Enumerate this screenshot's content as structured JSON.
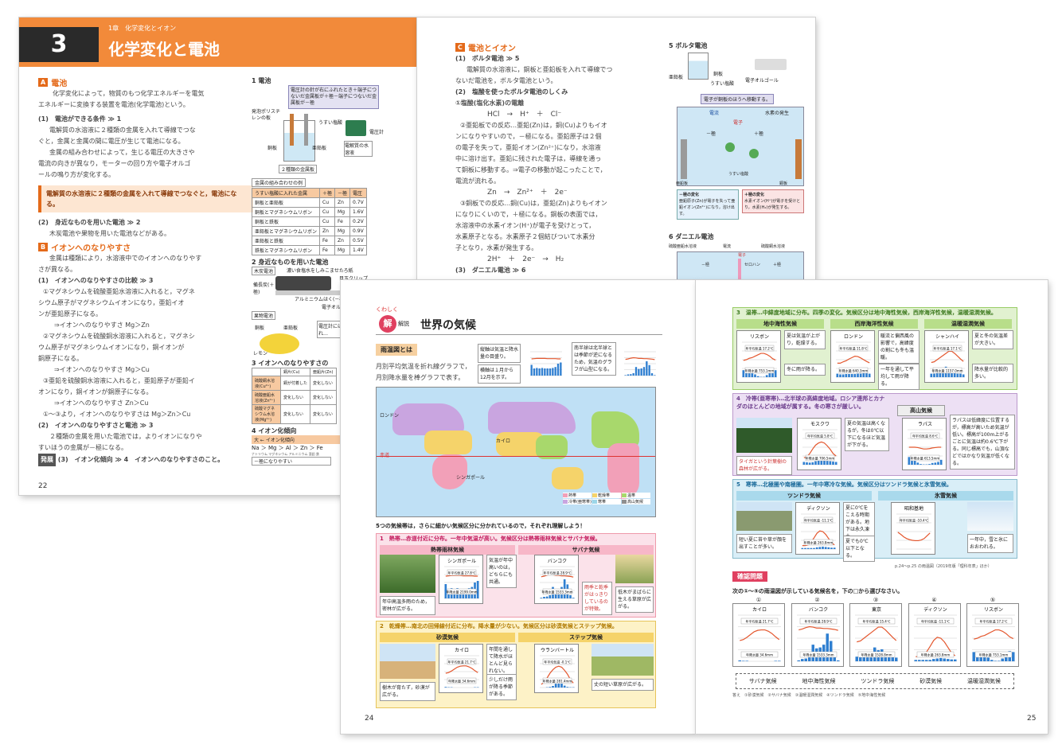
{
  "p22": {
    "chapter_sub": "1章　化学変化とイオン",
    "num": "3",
    "title": "化学変化と電池",
    "secA": {
      "badge": "A",
      "title": "電池"
    },
    "intro": [
      "化学変化によって，物質のもつ化学エネルギーを電気",
      "エネルギーに変換する装置を電池(化学電池)という。"
    ],
    "item1": "(1)　電池ができる条件 ≫ 1",
    "item1_lines": [
      "電解質の水溶液に２種類の金属を入れて導線でつな",
      "ぐと，金属と金属の間に電圧が生じて電池になる。",
      "金属の組み合わせによって，生じる電圧の大きさや",
      "電流の向きが異なり，モーターの回り方や電子オルゴ",
      "ールの鳴り方が変化する。"
    ],
    "key": "電解質の水溶液に２種類の金属を入れて導線でつなぐと，電池になる。",
    "item2": "(2)　身近なものを用いた電池 ≫ 2",
    "item2_line": "木炭電池や果物を用いた電池などがある。",
    "secB": {
      "badge": "B",
      "title": "イオンへのなりやすさ"
    },
    "b_lines": [
      "金属は種類により，水溶液中でのイオンへのなりやす",
      "さが異なる。"
    ],
    "b1": "(1)　イオンへのなりやすさの比較 ≫ 3",
    "b1_lines": [
      "①マグネシウムを硫酸亜鉛水溶液に入れると，マグネ",
      "シウム原子がマグネシウムイオンになり，亜鉛イオ",
      "ンが亜鉛原子になる。",
      "⇒イオンへのなりやすさ Mg＞Zn",
      "②マグネシウムを硫酸銅水溶液に入れると，マグネシ",
      "ウム原子がマグネシウムイオンになり，銅イオンが",
      "銅原子になる。",
      "⇒イオンへのなりやすさ Mg＞Cu",
      "③亜鉛を硫酸銅水溶液に入れると，亜鉛原子が亜鉛イ",
      "オンになり，銅イオンが銅原子になる。",
      "⇒イオンへのなりやすさ Zn＞Cu",
      "①～③より，イオンへのなりやすさは Mg＞Zn＞Cu"
    ],
    "b2": "(2)　イオンへのなりやすさと電池 ≫ 3",
    "b2_lines": [
      "２種類の金属を用いた電池では，よりイオンになりや",
      "すいほうの金属が－極になる。"
    ],
    "b3": "(3)　イオン化傾向 ≫ 4　イオンへのなりやすさのこと。",
    "b3_tag": "発展",
    "fig1_title": "1 電池",
    "fig1_note": "電圧計の針が右にふれたとき＋端子につないだ金属板が＋極－端子につないだ金属板が－極",
    "fig1_labels": [
      "発泡ポリスチレンの板",
      "うすい塩酸",
      "電圧計",
      "銅板",
      "亜鉛板",
      "電解質の水溶液",
      "２種類の金属板"
    ],
    "table_title": "金属の組み合わせの例",
    "table_rows": [
      [
        "うすい塩酸に入れた金属",
        "＋極",
        "－極",
        "電圧"
      ],
      [
        "銅板と亜鉛板",
        "Cu",
        "Zn",
        "0.7V"
      ],
      [
        "銅板とマグネシウムリボン",
        "Cu",
        "Mg",
        "1.6V"
      ],
      [
        "銅板と鉄板",
        "Cu",
        "Fe",
        "0.2V"
      ],
      [
        "亜鉛板とマグネシウムリボン",
        "Zn",
        "Mg",
        "0.9V"
      ],
      [
        "亜鉛板と鉄板",
        "Fe",
        "Zn",
        "0.5V"
      ],
      [
        "鉄板とマグネシウムリボン",
        "Fe",
        "Mg",
        "1.4V"
      ]
    ],
    "fig2_title": "2 身近なものを用いた電池",
    "fig2_labels": [
      "木炭電池",
      "濃い食塩水をしみこませたろ紙",
      "備長炭(＋極)",
      "目玉クリップ",
      "アルミニウムはく(－極)",
      "電子オルゴール",
      "果物電池",
      "銅板",
      "亜鉛板",
      "レモン",
      "電圧計には，電流が流れ…"
    ],
    "fig3_title": "3 イオンへのなりやすさの",
    "fig3_head": [
      "銅片(Cu)",
      "亜鉛片(Zn)"
    ],
    "fig3_rows": [
      "硫酸銅水溶液(Cu²⁺)",
      "硫酸亜鉛水溶液(Zn²⁺)",
      "硫酸マグネシウム水溶液(Mg²⁺)"
    ],
    "fig3_cells": [
      "銅が付着した",
      "変化しない",
      "変化しない",
      "変化しない",
      "変化しない",
      "変化しない"
    ],
    "fig4_title": "4 イオン化傾向",
    "fig4_bar": "大 ← イオン化傾向",
    "fig4_seq": "Na ＞ Mg ＞ Al ＞ Zn ＞ Fe",
    "fig4_sub": "ナトリウム マグネシウム アルミニウム 亜鉛 鉄",
    "fig4_foot": "－極になりやすい",
    "page_num": "22"
  },
  "p23": {
    "secC": {
      "badge": "C",
      "title": "電池とイオン"
    },
    "c1": "(1)　ボルタ電池 ≫ 5",
    "c1_lines": [
      "電解質の水溶液に，銅板と亜鉛板を入れて導線でつ",
      "ないだ電池を，ボルタ電池という。"
    ],
    "c2": "(2)　塩酸を使ったボルタ電池のしくみ",
    "c2a": "①塩酸(塩化水素)の電離",
    "eq1": "HCl　→　H⁺　＋　Cl⁻",
    "c2b_lines": [
      "②亜鉛板での反応…亜鉛(Zn)は，銅(Cu)よりもイオ",
      "ンになりやすいので，－極になる。亜鉛原子は２個",
      "の電子を失って，亜鉛イオン(Zn²⁺)になり，水溶液",
      "中に溶け出す。亜鉛に残された電子は，導線を通っ",
      "て銅板に移動する。⇒電子の移動が起こったことで，",
      "電流が流れる。"
    ],
    "eq2": "Zn　→　Zn²⁺　＋　2e⁻",
    "c2c_lines": [
      "③銅板での反応…銅(Cu)は，亜鉛(Zn)よりもイオン",
      "になりにくいので，＋極になる。銅板の表面では，",
      "水溶液中の水素イオン(H⁺)が電子を受けとって，",
      "水素原子となる。水素原子２個結びついて水素分",
      "子となり，水素が発生する。"
    ],
    "eq3": "2H⁺　＋　2e⁻　→　H₂",
    "c3": "(3)　ダニエル電池 ≫ 6",
    "fig5_title": "5 ボルタ電池",
    "fig5_labels": [
      "亜鉛板",
      "銅板",
      "うすい塩酸",
      "電子オルゴール",
      "電子が銅板のほうへ移動する。",
      "電流",
      "水素の発生",
      "電子",
      "－極",
      "＋極",
      "亜鉛板",
      "銅板",
      "うすい塩酸"
    ],
    "fig5_minus": "－極の変化",
    "fig5_minus_txt": "亜鉛原子(Zn)が電子を失って亜鉛イオン(Zn²⁺)になり，溶け出す。",
    "fig5_plus": "＋極の変化",
    "fig5_plus_txt": "水素イオン(H⁺)が電子を受けとり，水素(H₂)が発生する。",
    "fig6_title": "6 ダニエル電池",
    "fig6_labels": [
      "硫酸亜鉛水溶液",
      "電流",
      "硫酸銅水溶液",
      "電子",
      "セロハン",
      "－極",
      "＋極"
    ]
  },
  "p24": {
    "kuwashiku": "くわしく",
    "kaisetsu": "解説",
    "title": "世界の気候",
    "box_title": "雨温図とは",
    "box_lines": [
      "月別平均気温を折れ線グラフで，",
      "月別降水量を棒グラフで表す。"
    ],
    "notes": [
      "縦軸は気温と降水量の目盛り。",
      "横軸は１月から12月を示す。",
      "南半球は北半球とは季節が逆になるため，気温のグラフが山型になる。"
    ],
    "zones_intro": "5つの気候帯は，さらに細かい気候区分に分かれているので，それぞれ理解しよう！",
    "legend": [
      "熱帯",
      "乾燥帯",
      "温帯",
      "冷帯(亜寒帯)",
      "寒帯",
      "高山気候"
    ],
    "map_labels": [
      "シンガポール",
      "カイロ",
      "ロンドン",
      "赤道"
    ],
    "zone1": "1　熱帯…赤道付近に分布。一年中気温が高い。気候区分は熱帯雨林気候とサバナ気候。",
    "zone1_a": "熱帯雨林気候",
    "zone1_b": "サバナ気候",
    "z1_city_a": "シンガポール",
    "z1_city_b": "バンコク",
    "z1_temp_a": "年平均気温 27.8℃",
    "z1_temp_b": "年平均気温 28.9℃",
    "z1_rain_a": "年降水量 2199.0mm",
    "z1_rain_b": "年降水量 1533.3mm",
    "z1_note_a": "気温が年中高いのは，どちらにも共通。",
    "z1_note_b": "雨季と乾季がはっきりしているのが特徴。",
    "z1_cap_a": "年中高温多雨のため，密林が広がる。",
    "z1_cap_b": "低木がまばらに生える草原が広がる。",
    "zone2": "2　乾燥帯…南北の回帰線付近に分布。降水量が少ない。気候区分は砂漠気候とステップ気候。",
    "zone2_a": "砂漠気候",
    "zone2_b": "ステップ気候",
    "z2_city_a": "カイロ",
    "z2_city_b": "ウランバートル",
    "z2_temp_a": "年平均気温 21.7℃",
    "z2_temp_b": "年平均気温 -0.1℃",
    "z2_rain_a": "年降水量 34.6mm",
    "z2_rain_b": "年降水量 281.4mm",
    "z2_note_a": "年間を通して降水がほとんど見られない。",
    "z2_note_b": "少しだけ雨が降る季節がある。",
    "z2_cap_a": "樹木が育たず，砂漠が広がる。",
    "z2_cap_b": "丈の短い草原が広がる。",
    "page_num": "24"
  },
  "p25": {
    "zone3": "3　温帯…中緯度地域に分布。四季の変化。気候区分は地中海性気候，西岸海洋性気候，温暖湿潤気候。",
    "z3_heads": [
      "地中海性気候",
      "西岸海洋性気候",
      "温暖湿潤気候"
    ],
    "z3_cities": [
      "リスボン",
      "ロンドン",
      "シャンハイ"
    ],
    "z3_temps": [
      "年平均気温 17.2℃",
      "年平均気温 11.8℃",
      "年平均気温 17.1℃"
    ],
    "z3_rains": [
      "年降水量 753.1mm",
      "年降水量 640.3mm",
      "年降水量 1157.0mm"
    ],
    "z3_notes": [
      "夏は気温が上がり，乾燥する。",
      "冬に雨が降る。",
      "暖流と偏西風の影響で，高緯度の割にも冬も温暖。",
      "一年を通して平均して雨が降る。",
      "夏と冬の気温差が大きい。",
      "降水量が比較的多い。"
    ],
    "zone4": "4　冷帯(亜寒帯)…北半球の高緯度地域。ロシア連邦とカナダのほとんどの地域が属する。冬の寒さが厳しい。",
    "z4_city": "モスクワ",
    "z4_temp": "年平均気温 5.8℃",
    "z4_rain": "年降水量 706.5mm",
    "z4_note": "夏の気温は高くなるが，冬は0℃以下になるほど気温が下がる。",
    "z4_cap": "タイガという針葉樹の森林が広がる。",
    "highland_head": "高山気候",
    "hl_city": "ラパス",
    "hl_temp": "年平均気温 8.6℃",
    "hl_rain": "年降水量 613.5mm",
    "hl_note": "ラパスは低緯度に位置するが，標高が高いため気温が低い。標高が100m上がるごとに気温は約0.6℃下がる。同じ標高でも，山頂などではかなり気温が低くなる。",
    "zone5": "5　寒帯…北極圏や南極圏。一年中寒冷な気候。気候区分はツンドラ気候と氷雪気候。",
    "z5_heads": [
      "ツンドラ気候",
      "氷雪気候"
    ],
    "z5_city_a": "ディクソン",
    "z5_city_b": "昭和基地",
    "z5_temp_a": "年平均気温 -11.1℃",
    "z5_temp_b": "年平均気温 -10.4℃",
    "z5_rain_a": "年降水量 263.8mm",
    "z5_note_a": "夏に0℃をこえる時期がある。地下は永久凍土。",
    "z5_note_b": "夏でも0℃以下となる。",
    "z5_cap_a": "短い夏に苔や草が顔を出すことが多い。",
    "z5_cap_b": "一年中，雪と氷におおわれる。",
    "source": "p.24～p.25 の雨温図（2019年版「理科年表」ほか）",
    "quiz_title": "確認問題",
    "quiz_q": "次の①～⑤の雨温図が示している気候名を，下の□から選びなさい。",
    "quiz_nums": [
      "①",
      "②",
      "③",
      "④",
      "⑤"
    ],
    "quiz_cities": [
      "カイロ",
      "バンコク",
      "東京",
      "ディクソン",
      "リスボン"
    ],
    "quiz_temps": [
      "年平均気温 21.7℃",
      "年平均気温 28.9℃",
      "年平均気温 15.4℃",
      "年平均気温 -11.1℃",
      "年平均気温 17.2℃"
    ],
    "quiz_rains": [
      "年降水量 34.6mm",
      "年降水量 1533.3mm",
      "年降水量 1528.8mm",
      "年降水量 263.8mm",
      "年降水量 753.1mm"
    ],
    "options": [
      "サバナ気候",
      "地中海性気候",
      "ツンドラ気候",
      "砂漠気候",
      "温暖湿潤気候"
    ],
    "answers": "答え　①砂漠気候　②サバナ気候　③温暖湿潤気候　④ツンドラ気候　⑤地中海性気候",
    "page_num": "25"
  },
  "colors": {
    "orange": "#f28a3a",
    "tropical": "#f2a0b8",
    "dry": "#f5d36a",
    "temperate": "#a8d86c",
    "cold": "#c9a5e0",
    "polar": "#9cd6e8",
    "green": "#d6edc2",
    "blue": "#cfe7f5"
  }
}
